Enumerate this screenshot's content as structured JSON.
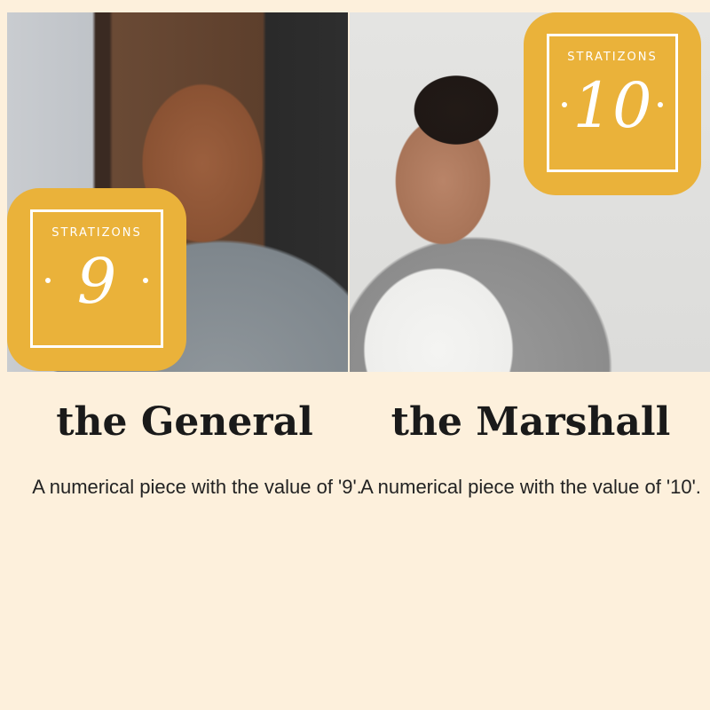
{
  "brand": "STRATIZONS",
  "pieces": [
    {
      "number": "9",
      "title": "the General",
      "description": "A numerical piece with the value of '9'."
    },
    {
      "number": "10",
      "title": "the Marshall",
      "description": "A numerical piece with the value of '10'."
    }
  ],
  "colors": {
    "background": "#fdf0dc",
    "badge": "#eab23a",
    "text": "#1a1a1a"
  }
}
